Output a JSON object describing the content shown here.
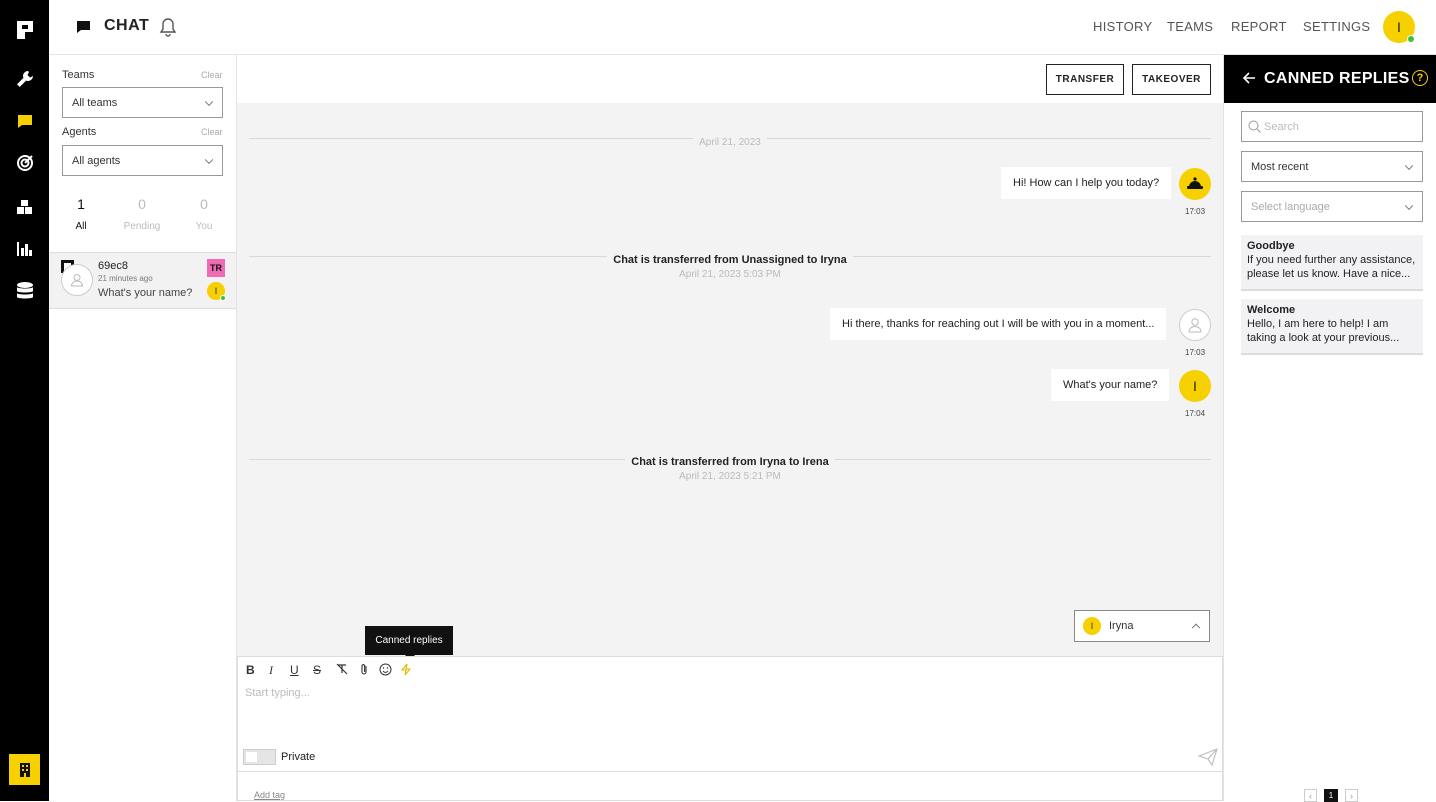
{
  "app": {
    "title": "CHAT",
    "user_initial": "I"
  },
  "nav": [
    "HISTORY",
    "TEAMS",
    "REPORT",
    "SETTINGS"
  ],
  "filters": {
    "teams_label": "Teams",
    "teams_clear": "Clear",
    "teams_value": "All teams",
    "agents_label": "Agents",
    "agents_clear": "Clear",
    "agents_value": "All agents"
  },
  "counts": [
    {
      "num": "1",
      "cap": "All"
    },
    {
      "num": "0",
      "cap": "Pending"
    },
    {
      "num": "0",
      "cap": "You"
    }
  ],
  "conversation": {
    "id": "69ec8",
    "time": "21 minutes ago",
    "preview": "What's your name?",
    "team_badge": "TR",
    "agent_initial": "I",
    "team_badge_color": "#f06ab6"
  },
  "chat": {
    "transfer_label": "TRANSFER",
    "takeover_label": "TAKEOVER",
    "date_sep": "April 21, 2023",
    "messages": [
      {
        "text": "Hi! How can I help you today?",
        "time": "17:03"
      },
      {
        "text": "Hi there, thanks for reaching out I will be with you in a moment...",
        "time": "17:03"
      },
      {
        "text": "What's your name?",
        "time": "17:04",
        "initial": "I"
      }
    ],
    "events": [
      {
        "text": "Chat is transferred from Unassigned to Iryna",
        "date": "April 21, 2023 5:03 PM"
      },
      {
        "text": "Chat is transferred from Iryna to Irena",
        "date": "April 21, 2023 5:21 PM"
      }
    ],
    "agent_select": {
      "initial": "I",
      "name": "Iryna"
    }
  },
  "composer": {
    "tooltip": "Canned replies",
    "placeholder": "Start typing...",
    "private_label": "Private",
    "add_tag": "Add tag"
  },
  "canned": {
    "title": "CANNED REPLIES",
    "search_placeholder": "Search",
    "sort_value": "Most recent",
    "language_placeholder": "Select language",
    "items": [
      {
        "title": "Goodbye",
        "body": "If you need further any assistance, please let us know. Have a nice..."
      },
      {
        "title": "Welcome",
        "body": "Hello, I am here to help! I am taking a look at your previous..."
      }
    ],
    "page": "1"
  },
  "colors": {
    "accent": "#f7d000",
    "dark": "#000000"
  }
}
